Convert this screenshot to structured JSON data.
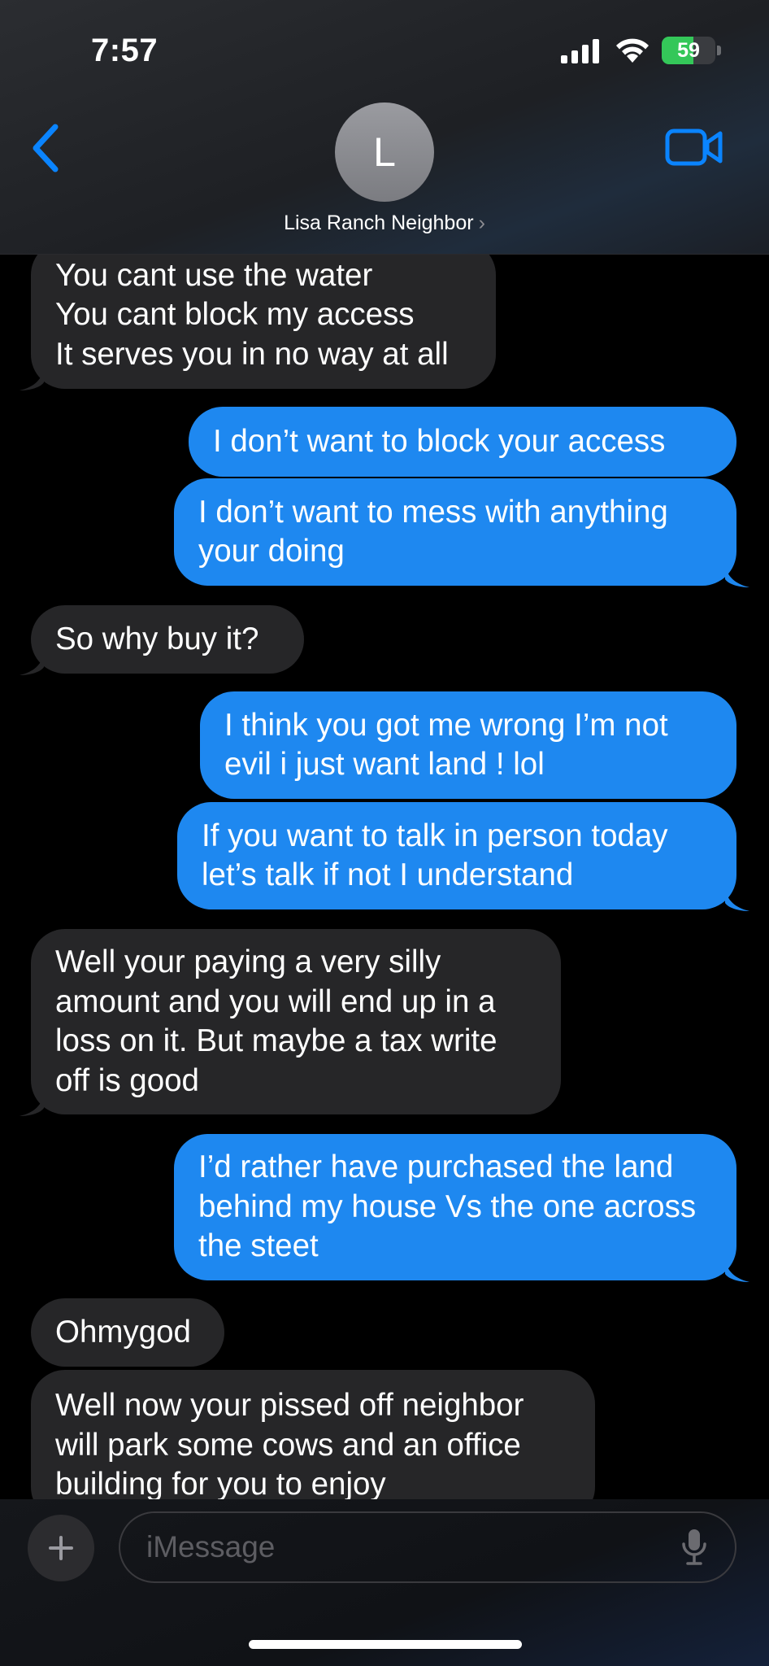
{
  "status_bar": {
    "time": "7:57",
    "battery_percent": "59",
    "battery_level": 0.59
  },
  "header": {
    "avatar_initial": "L",
    "contact_name": "Lisa Ranch Neighbor",
    "contact_chevron": "›"
  },
  "messages": [
    {
      "direction": "incoming",
      "text": "You cant use the water\nYou cant block my access\nIt serves you in no way at all"
    },
    {
      "direction": "outgoing",
      "text": "I don’t want to block your access"
    },
    {
      "direction": "outgoing",
      "text": "I don’t want to mess with anything your doing"
    },
    {
      "direction": "incoming",
      "text": "So why buy it?"
    },
    {
      "direction": "outgoing",
      "text": "I think you got me wrong I’m not evil i just want land ! lol"
    },
    {
      "direction": "outgoing",
      "text": "If you want to talk in person today let’s talk if not I understand"
    },
    {
      "direction": "incoming",
      "text": "Well your paying a very silly amount and you will end up in a loss on it. But maybe a tax write off is good"
    },
    {
      "direction": "outgoing",
      "text": "I’d rather have purchased the land behind my house Vs the one across the steet"
    },
    {
      "direction": "incoming",
      "text": "Ohmygod"
    },
    {
      "direction": "incoming",
      "text": "Well now your pissed off neighbor will park some cows and an office building for you to enjoy"
    }
  ],
  "composer": {
    "placeholder": "iMessage"
  },
  "colors": {
    "outgoing_bubble": "#1e88f0",
    "incoming_bubble": "#262628",
    "accent": "#0a84ff"
  },
  "icons": [
    "back-chevron-icon",
    "video-call-icon",
    "signal-icon",
    "wifi-icon",
    "battery-icon",
    "plus-icon",
    "microphone-icon"
  ]
}
